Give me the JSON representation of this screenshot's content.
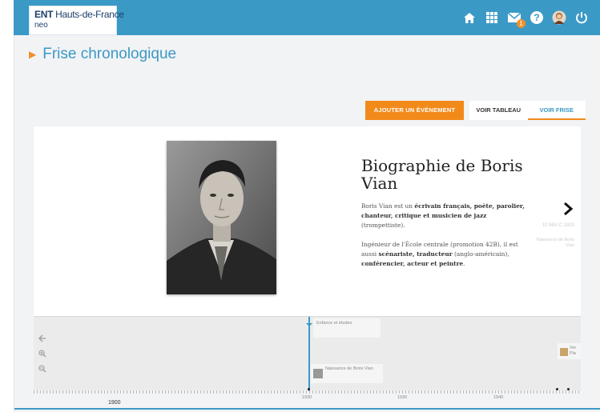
{
  "header": {
    "logo_brand": "ENT",
    "logo_region": "Hauts-de-France",
    "logo_sub": "neo",
    "icons": [
      "home-icon",
      "apps-grid-icon",
      "mail-icon",
      "help-icon",
      "user-avatar",
      "power-icon"
    ],
    "mail_badge": "1",
    "bar_color": "#3b99c6"
  },
  "page": {
    "title": "Frise chronologique"
  },
  "toolbar": {
    "add_event": "AJOUTER UN ÉVÉNEMENT",
    "tab_table": "VOIR TABLEAU",
    "tab_timeline": "VOIR FRISE",
    "accent_color": "#f28a1a"
  },
  "slide": {
    "title": "Biographie de Boris Vian",
    "p1_a": "Boris Vian est un ",
    "p1_b": "écrivain français, poète, parolier, chanteur, critique et musicien de jazz",
    "p1_c": " (trompettiste).",
    "p2_a": "Ingénieur de l'École centrale (promotion 42B), il est aussi ",
    "p2_b": "scénariste, traducteur",
    "p2_c": " (anglo-américain), ",
    "p2_d": "conférencier, acteur et peintre",
    "p2_e": ".",
    "next_date": "10 MAI C 1920",
    "next_label": "Naissance de Boris Vian"
  },
  "timeline": {
    "event_top": "Enfance et études",
    "event_bottom": "Naissance de Boris Vian",
    "event_right": "Ver Pla",
    "axis_1920": "1920",
    "axis_1930": "1930",
    "axis_1940": "1940",
    "axis_1900": "1900"
  }
}
